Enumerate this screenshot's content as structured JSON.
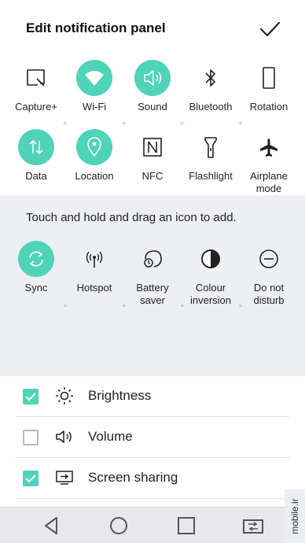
{
  "header": {
    "title": "Edit notification panel"
  },
  "active_tiles": [
    {
      "label": "Capture+",
      "icon": "capture-plus-icon",
      "on": false
    },
    {
      "label": "Wi-Fi",
      "icon": "wifi-icon",
      "on": true
    },
    {
      "label": "Sound",
      "icon": "sound-icon",
      "on": true
    },
    {
      "label": "Bluetooth",
      "icon": "bluetooth-icon",
      "on": false
    },
    {
      "label": "Rotation",
      "icon": "rotation-icon",
      "on": false
    },
    {
      "label": "Data",
      "icon": "data-icon",
      "on": true
    },
    {
      "label": "Location",
      "icon": "location-icon",
      "on": true
    },
    {
      "label": "NFC",
      "icon": "nfc-icon",
      "on": false
    },
    {
      "label": "Flashlight",
      "icon": "flashlight-icon",
      "on": false
    },
    {
      "label": "Airplane\nmode",
      "icon": "airplane-icon",
      "on": false
    }
  ],
  "inactive": {
    "hint": "Touch and hold and drag an icon to add.",
    "tiles": [
      {
        "label": "Sync",
        "icon": "sync-icon",
        "on": true
      },
      {
        "label": "Hotspot",
        "icon": "hotspot-icon",
        "on": false
      },
      {
        "label": "Battery\nsaver",
        "icon": "battery-saver-icon",
        "on": false
      },
      {
        "label": "Colour\ninversion",
        "icon": "colour-inversion-icon",
        "on": false
      },
      {
        "label": "Do not\ndisturb",
        "icon": "do-not-disturb-icon",
        "on": false
      }
    ]
  },
  "settings": [
    {
      "label": "Brightness",
      "checked": true,
      "icon": "brightness-icon"
    },
    {
      "label": "Volume",
      "checked": false,
      "icon": "volume-icon"
    },
    {
      "label": "Screen sharing",
      "checked": true,
      "icon": "screen-sharing-icon"
    }
  ],
  "navbar": [
    "back-icon",
    "home-icon",
    "recents-icon",
    "dual-window-icon"
  ],
  "watermark": "mobile.ir",
  "colors": {
    "accent": "#4fd3b9",
    "panel_bg": "#eeeff3",
    "navbar_bg": "#e8e8ec"
  }
}
